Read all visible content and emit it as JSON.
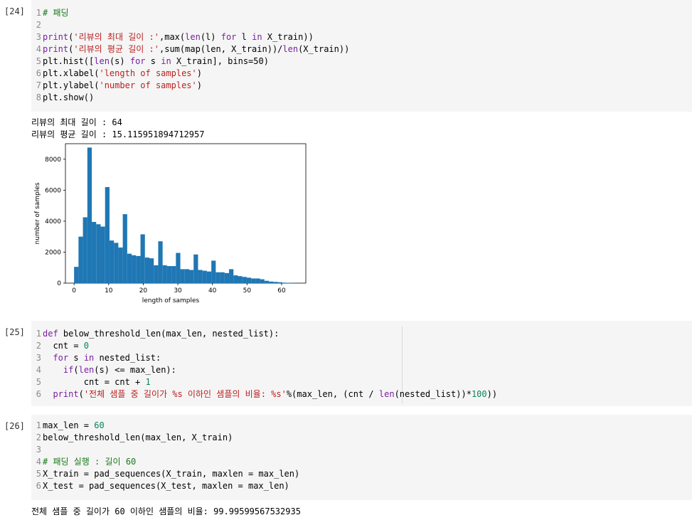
{
  "cells": [
    {
      "prompt": "[24]",
      "lines": [
        {
          "n": "1",
          "segs": [
            {
              "t": "# 패딩",
              "c": "cm"
            }
          ]
        },
        {
          "n": "2",
          "segs": []
        },
        {
          "n": "3",
          "segs": [
            {
              "t": "print",
              "c": "fn"
            },
            {
              "t": "(",
              "c": ""
            },
            {
              "t": "'리뷰의 최대 길이 :'",
              "c": "str"
            },
            {
              "t": ",max(",
              "c": ""
            },
            {
              "t": "len",
              "c": "fn"
            },
            {
              "t": "(l) ",
              "c": ""
            },
            {
              "t": "for",
              "c": "kw"
            },
            {
              "t": " l ",
              "c": ""
            },
            {
              "t": "in",
              "c": "kw"
            },
            {
              "t": " X_train))",
              "c": ""
            }
          ]
        },
        {
          "n": "4",
          "segs": [
            {
              "t": "print",
              "c": "fn"
            },
            {
              "t": "(",
              "c": ""
            },
            {
              "t": "'리뷰의 평균 길이 :'",
              "c": "str"
            },
            {
              "t": ",sum(map(len, X_train))/",
              "c": ""
            },
            {
              "t": "len",
              "c": "fn"
            },
            {
              "t": "(X_train))",
              "c": ""
            }
          ]
        },
        {
          "n": "5",
          "segs": [
            {
              "t": "plt.hist([",
              "c": ""
            },
            {
              "t": "len",
              "c": "fn"
            },
            {
              "t": "(s) ",
              "c": ""
            },
            {
              "t": "for",
              "c": "kw"
            },
            {
              "t": " s ",
              "c": ""
            },
            {
              "t": "in",
              "c": "kw"
            },
            {
              "t": " X_train], bins=50)",
              "c": ""
            }
          ]
        },
        {
          "n": "6",
          "segs": [
            {
              "t": "plt.xlabel(",
              "c": ""
            },
            {
              "t": "'length of samples'",
              "c": "str"
            },
            {
              "t": ")",
              "c": ""
            }
          ]
        },
        {
          "n": "7",
          "segs": [
            {
              "t": "plt.ylabel(",
              "c": ""
            },
            {
              "t": "'number of samples'",
              "c": "str"
            },
            {
              "t": ")",
              "c": ""
            }
          ]
        },
        {
          "n": "8",
          "segs": [
            {
              "t": "plt.show()",
              "c": ""
            }
          ]
        }
      ],
      "outputs": [
        "리뷰의 최대 길이 : 64",
        "리뷰의 평균 길이 : 15.115951894712957"
      ]
    },
    {
      "prompt": "[25]",
      "lines": [
        {
          "n": "1",
          "segs": [
            {
              "t": "def",
              "c": "kw"
            },
            {
              "t": " below_threshold_len(max_len, nested_list):",
              "c": ""
            }
          ]
        },
        {
          "n": "2",
          "segs": [
            {
              "t": "  cnt = ",
              "c": ""
            },
            {
              "t": "0",
              "c": "num"
            }
          ]
        },
        {
          "n": "3",
          "segs": [
            {
              "t": "  ",
              "c": ""
            },
            {
              "t": "for",
              "c": "kw"
            },
            {
              "t": " s ",
              "c": ""
            },
            {
              "t": "in",
              "c": "kw"
            },
            {
              "t": " nested_list:",
              "c": ""
            }
          ]
        },
        {
          "n": "4",
          "segs": [
            {
              "t": "    ",
              "c": ""
            },
            {
              "t": "if",
              "c": "kw"
            },
            {
              "t": "(",
              "c": ""
            },
            {
              "t": "len",
              "c": "fn"
            },
            {
              "t": "(s) <= max_len):",
              "c": ""
            }
          ]
        },
        {
          "n": "5",
          "segs": [
            {
              "t": "        cnt = cnt + ",
              "c": ""
            },
            {
              "t": "1",
              "c": "num"
            }
          ]
        },
        {
          "n": "6",
          "segs": [
            {
              "t": "  ",
              "c": ""
            },
            {
              "t": "print",
              "c": "fn"
            },
            {
              "t": "(",
              "c": ""
            },
            {
              "t": "'전체 샘플 중 길이가 %s 이하인 샘플의 비율: %s'",
              "c": "str"
            },
            {
              "t": "%(max_len, (cnt / ",
              "c": ""
            },
            {
              "t": "len",
              "c": "fn"
            },
            {
              "t": "(nested_list))*",
              "c": ""
            },
            {
              "t": "100",
              "c": "num"
            },
            {
              "t": "))",
              "c": ""
            }
          ]
        }
      ],
      "outputs": []
    },
    {
      "prompt": "[26]",
      "lines": [
        {
          "n": "1",
          "segs": [
            {
              "t": "max_len = ",
              "c": ""
            },
            {
              "t": "60",
              "c": "num"
            }
          ]
        },
        {
          "n": "2",
          "segs": [
            {
              "t": "below_threshold_len(max_len, X_train)",
              "c": ""
            }
          ]
        },
        {
          "n": "3",
          "segs": []
        },
        {
          "n": "4",
          "segs": [
            {
              "t": "# 패딩 실행 : 길이 60",
              "c": "cm"
            }
          ]
        },
        {
          "n": "5",
          "segs": [
            {
              "t": "X_train = pad_sequences(X_train, maxlen = max_len)",
              "c": ""
            }
          ]
        },
        {
          "n": "6",
          "segs": [
            {
              "t": "X_test = pad_sequences(X_test, maxlen = max_len)",
              "c": ""
            }
          ]
        }
      ],
      "outputs": [
        "전체 샘플 중 길이가 60 이하인 샘플의 비율: 99.99599567532935"
      ]
    }
  ],
  "chart_data": {
    "type": "bar",
    "xlabel": "length of samples",
    "ylabel": "number of samples",
    "xlim": [
      -2.5,
      67
    ],
    "ylim": [
      0,
      9000
    ],
    "xticks": [
      0,
      10,
      20,
      30,
      40,
      50,
      60
    ],
    "yticks": [
      0,
      2000,
      4000,
      6000,
      8000
    ],
    "bin_width": 1.28,
    "bin_start": 0,
    "color": "#1f77b4",
    "values": [
      1050,
      3000,
      4250,
      8750,
      3950,
      3800,
      3650,
      6200,
      2750,
      2600,
      2300,
      4450,
      1900,
      1800,
      1750,
      3150,
      1650,
      1600,
      1150,
      2700,
      1150,
      1100,
      1100,
      1950,
      900,
      900,
      850,
      1850,
      850,
      800,
      750,
      1450,
      700,
      700,
      650,
      900,
      500,
      450,
      400,
      350,
      300,
      300,
      250,
      150,
      100,
      80,
      60,
      30,
      20,
      10
    ]
  }
}
